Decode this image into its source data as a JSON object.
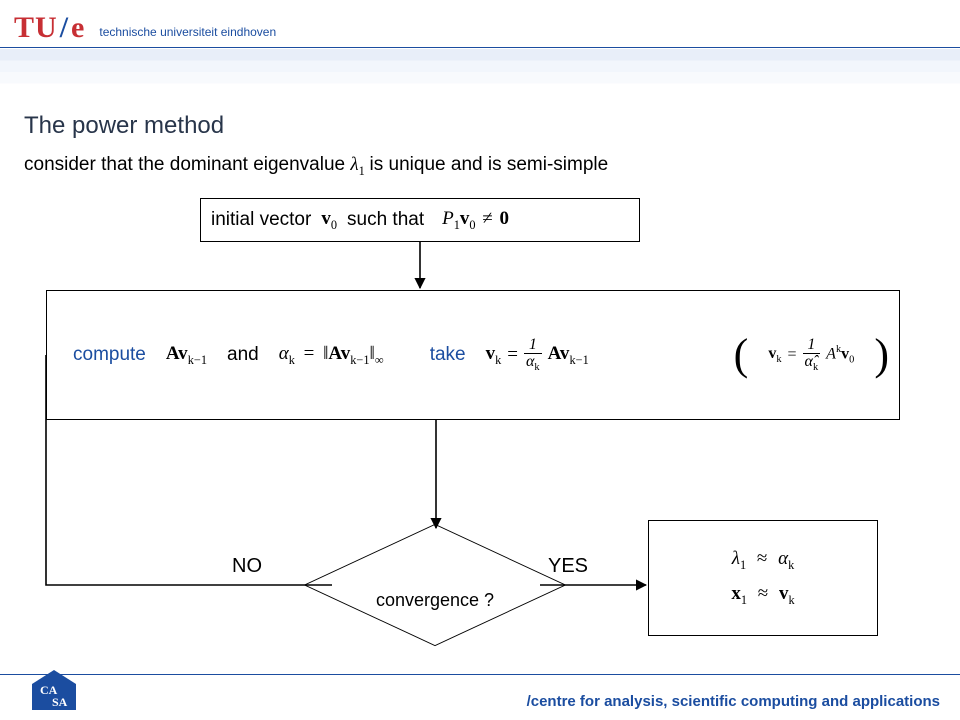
{
  "brand": {
    "logo_tu": "TU",
    "logo_e": "e",
    "university": "technische universiteit eindhoven"
  },
  "slide": {
    "title": "The power method",
    "premise_pre": "consider that the dominant eigenvalue",
    "premise_lambda": "λ",
    "premise_lambda_sub": "1",
    "premise_post": "is unique and  is semi-simple"
  },
  "flow": {
    "initial_pre": "initial vector",
    "initial_vec": "v",
    "initial_vec_sub": "0",
    "initial_post": "such that",
    "initial_cond_P": "P",
    "initial_cond_Psub": "1",
    "initial_cond_v": "v",
    "initial_cond_vsub": "0",
    "initial_cond_neq": "≠",
    "initial_cond_zero": "0",
    "compute_word": "compute",
    "compute_Av": "Av",
    "compute_Av_sub": "k−1",
    "and_word": "and",
    "alpha": "α",
    "alpha_sub": "k",
    "eq": "=",
    "norm_open": "‖",
    "norm_Av": "Av",
    "norm_Av_sub": "k−1",
    "norm_close": "‖",
    "norm_inf": "∞",
    "take_word": "take",
    "vk": "v",
    "vk_sub": "k",
    "one": "1",
    "Av2": "Av",
    "Av2_sub": "k−1",
    "paren_open": "(",
    "paren_vk": "v",
    "paren_vk_sub": "k",
    "alpha_hat": "α̂",
    "Ak": "A",
    "Ak_sup": "k",
    "v0": "v",
    "v0_sub": "0",
    "paren_close": ")",
    "decision": "convergence ?",
    "no": "NO",
    "yes": "YES",
    "res_lambda": "λ",
    "res_lambda_sub": "1",
    "approx": "≈",
    "res_alpha": "α",
    "res_alpha_sub": "k",
    "res_x": "x",
    "res_x_sub": "1",
    "res_v": "v",
    "res_v_sub": "k"
  },
  "footer": {
    "casa_ca": "CA",
    "casa_sa": "SA",
    "center": "/centre for analysis, scientific computing and applications"
  }
}
